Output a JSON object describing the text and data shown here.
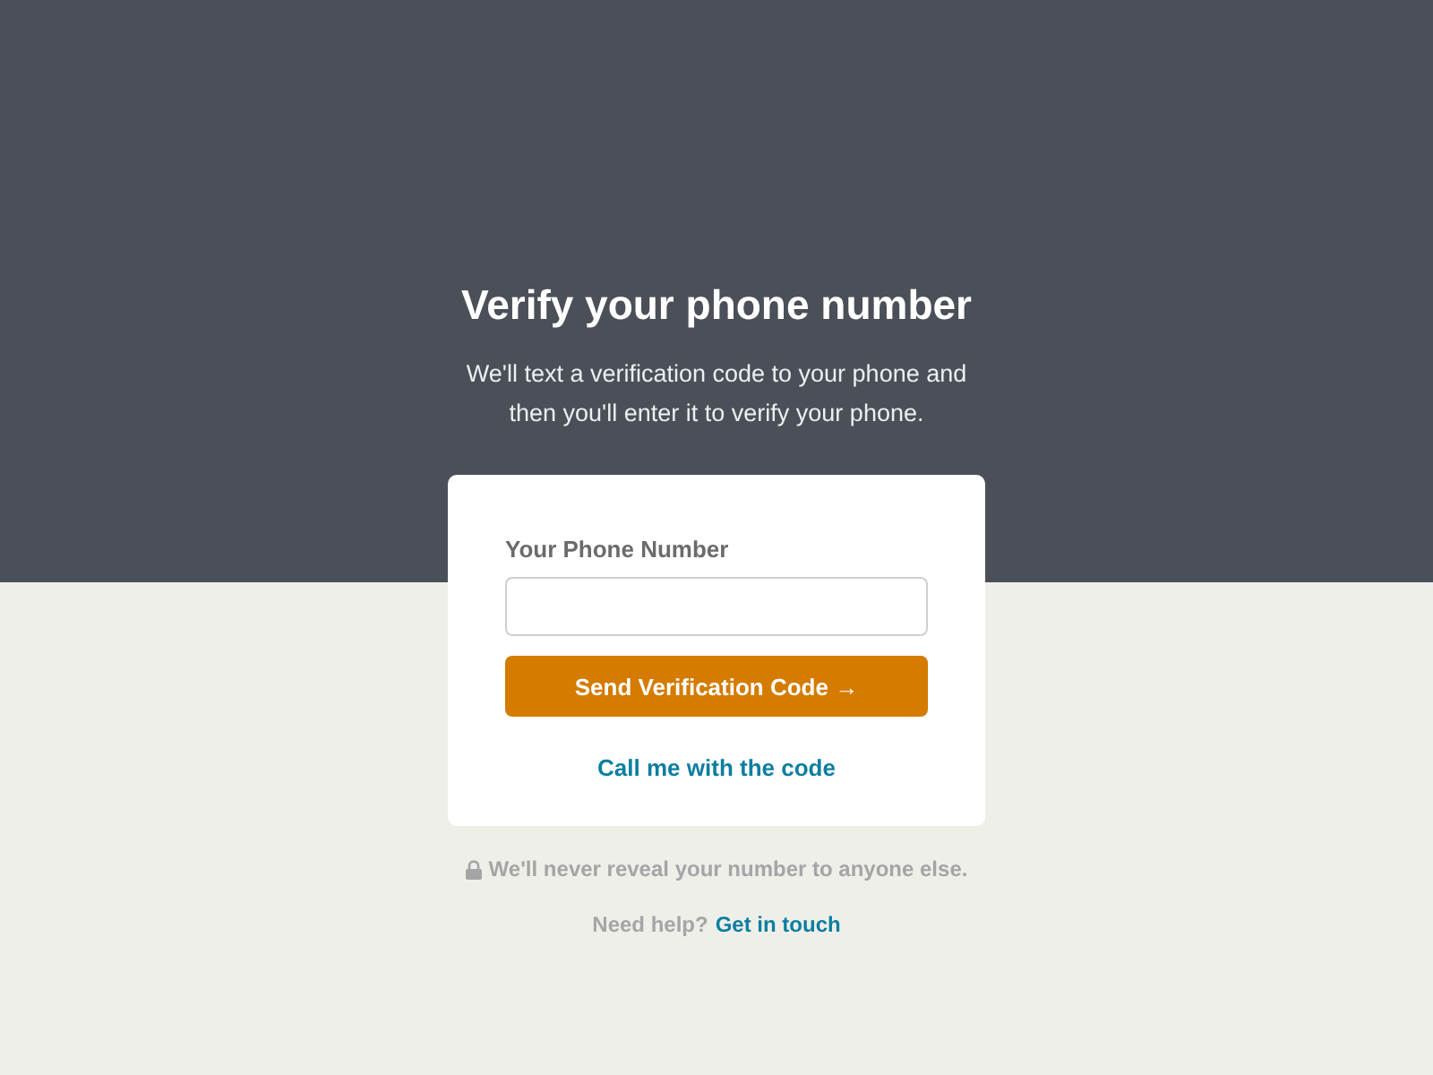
{
  "title": "Verify your phone number",
  "subtitle": "We'll text a verification code to your phone and then you'll enter it to verify your phone.",
  "form": {
    "label": "Your Phone Number",
    "send_button": "Send Verification Code →",
    "call_link": "Call me with the code"
  },
  "privacy_note": "We'll never reveal your number to anyone else.",
  "help": {
    "text": "Need help?",
    "link": "Get in touch"
  }
}
